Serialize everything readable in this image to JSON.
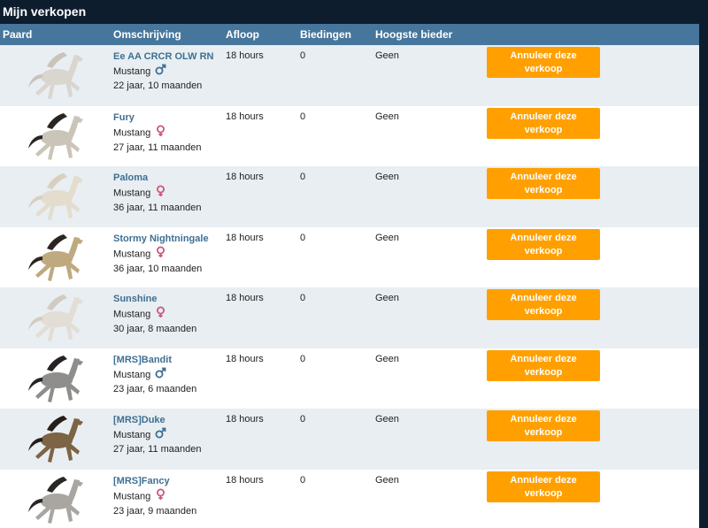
{
  "page": {
    "title": "Mijn verkopen"
  },
  "table": {
    "headers": {
      "paard": "Paard",
      "omschrijving": "Omschrijving",
      "afloop": "Afloop",
      "biedingen": "Biedingen",
      "hoogste_bieder": "Hoogste bieder"
    },
    "rows": [
      {
        "name": "Ee AA CRCR OLW RN",
        "breed": "Mustang",
        "gender": "male",
        "age": "22 jaar, 10 maanden",
        "afloop": "18 hours",
        "biedingen": "0",
        "bieder": "Geen",
        "btn_line1": "Annuleer deze",
        "btn_line2": "verkoop",
        "coat": "#d9d5cf",
        "mane": "#c9c4bb"
      },
      {
        "name": "Fury",
        "breed": "Mustang",
        "gender": "female",
        "age": "27 jaar, 11 maanden",
        "afloop": "18 hours",
        "biedingen": "0",
        "bieder": "Geen",
        "btn_line1": "Annuleer deze",
        "btn_line2": "verkoop",
        "coat": "#cbc4b8",
        "mane": "#2b2522"
      },
      {
        "name": "Paloma",
        "breed": "Mustang",
        "gender": "female",
        "age": "36 jaar, 11 maanden",
        "afloop": "18 hours",
        "biedingen": "0",
        "bieder": "Geen",
        "btn_line1": "Annuleer deze",
        "btn_line2": "verkoop",
        "coat": "#e4dccd",
        "mane": "#d9cfbe"
      },
      {
        "name": "Stormy Nightningale",
        "breed": "Mustang",
        "gender": "female",
        "age": "36 jaar, 10 maanden",
        "afloop": "18 hours",
        "biedingen": "0",
        "bieder": "Geen",
        "btn_line1": "Annuleer deze",
        "btn_line2": "verkoop",
        "coat": "#bfa97f",
        "mane": "#2b2420"
      },
      {
        "name": "Sunshine",
        "breed": "Mustang",
        "gender": "female",
        "age": "30 jaar, 8 maanden",
        "afloop": "18 hours",
        "biedingen": "0",
        "bieder": "Geen",
        "btn_line1": "Annuleer deze",
        "btn_line2": "verkoop",
        "coat": "#e2ddd5",
        "mane": "#d2cbc1"
      },
      {
        "name": "[MRS]Bandit",
        "breed": "Mustang",
        "gender": "male",
        "age": "23 jaar, 6 maanden",
        "afloop": "18 hours",
        "biedingen": "0",
        "bieder": "Geen",
        "btn_line1": "Annuleer deze",
        "btn_line2": "verkoop",
        "coat": "#8f8e8c",
        "mane": "#262322"
      },
      {
        "name": "[MRS]Duke",
        "breed": "Mustang",
        "gender": "male",
        "age": "27 jaar, 11 maanden",
        "afloop": "18 hours",
        "biedingen": "0",
        "bieder": "Geen",
        "btn_line1": "Annuleer deze",
        "btn_line2": "verkoop",
        "coat": "#7d6444",
        "mane": "#261e18"
      },
      {
        "name": "[MRS]Fancy",
        "breed": "Mustang",
        "gender": "female",
        "age": "23 jaar, 9 maanden",
        "afloop": "18 hours",
        "biedingen": "0",
        "bieder": "Geen",
        "btn_line1": "Annuleer deze",
        "btn_line2": "verkoop",
        "coat": "#a9a6a2",
        "mane": "#2a2624"
      }
    ]
  }
}
